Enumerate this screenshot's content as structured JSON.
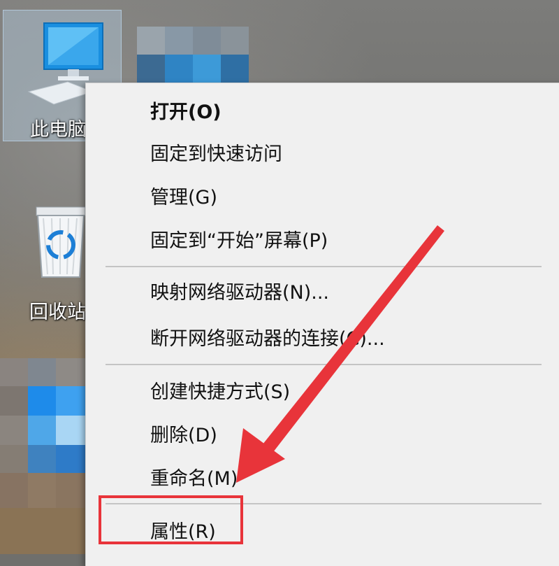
{
  "desktop": {
    "icons": [
      {
        "label": "此电脑",
        "icon": "monitor-icon"
      },
      {
        "label": "回收站",
        "icon": "recycle-bin-icon"
      }
    ]
  },
  "context_menu": {
    "groups": [
      [
        {
          "label": "打开(O)",
          "bold": true
        },
        {
          "label": "固定到快速访问"
        },
        {
          "label": "管理(G)"
        },
        {
          "label": "固定到“开始”屏幕(P)"
        }
      ],
      [
        {
          "label": "映射网络驱动器(N)..."
        },
        {
          "label": "断开网络驱动器的连接(C)..."
        }
      ],
      [
        {
          "label": "创建快捷方式(S)"
        },
        {
          "label": "删除(D)"
        },
        {
          "label": "重命名(M)"
        }
      ],
      [
        {
          "label": "属性(R)"
        }
      ]
    ]
  },
  "annotation": {
    "arrow_color": "#e8343a",
    "box_color": "#e8343a"
  }
}
